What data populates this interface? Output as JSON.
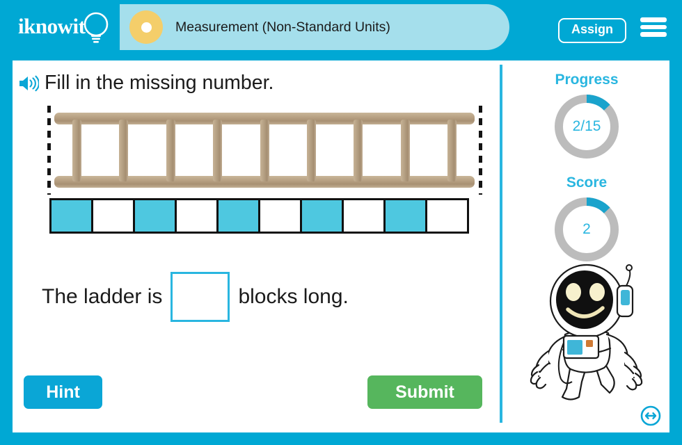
{
  "header": {
    "logo_text": "iknowit",
    "logo_icon": "lightbulb-icon",
    "title": "Measurement (Non-Standard Units)",
    "assign_label": "Assign",
    "menu_icon": "hamburger-menu-icon",
    "bg_color": "#00a8d4",
    "pill_color": "#a5dfec",
    "dot_color": "#f4ce6a"
  },
  "question": {
    "audio_icon": "speaker-icon",
    "prompt": "Fill in the missing number.",
    "object": "ladder",
    "sentence_before": "The ladder is",
    "sentence_after": "blocks long.",
    "answer_value": "",
    "answer_placeholder": ""
  },
  "blocks": {
    "count": 10,
    "states": [
      "on",
      "off",
      "on",
      "off",
      "on",
      "off",
      "on",
      "off",
      "on",
      "off"
    ],
    "on_color": "#4ec8e0",
    "off_color": "#ffffff",
    "border_color": "#111111"
  },
  "ladder": {
    "rung_count": 9,
    "rail_color": "#b5a083",
    "dashed_guide_color": "#141414"
  },
  "actions": {
    "hint_label": "Hint",
    "hint_color": "#0aa6d6",
    "submit_label": "Submit",
    "submit_color": "#56b65d",
    "next_icon": "arrows-left-right-circle-icon"
  },
  "sidebar": {
    "progress": {
      "label": "Progress",
      "value": "2/15",
      "current": 2,
      "total": 15,
      "percent": 13,
      "arc_color": "#1aa3cc",
      "track_color": "#bcbcbc"
    },
    "score": {
      "label": "Score",
      "value": "2",
      "percent": 13,
      "arc_color": "#1aa3cc",
      "track_color": "#bcbcbc"
    },
    "mascot": "astronaut-mascot"
  }
}
